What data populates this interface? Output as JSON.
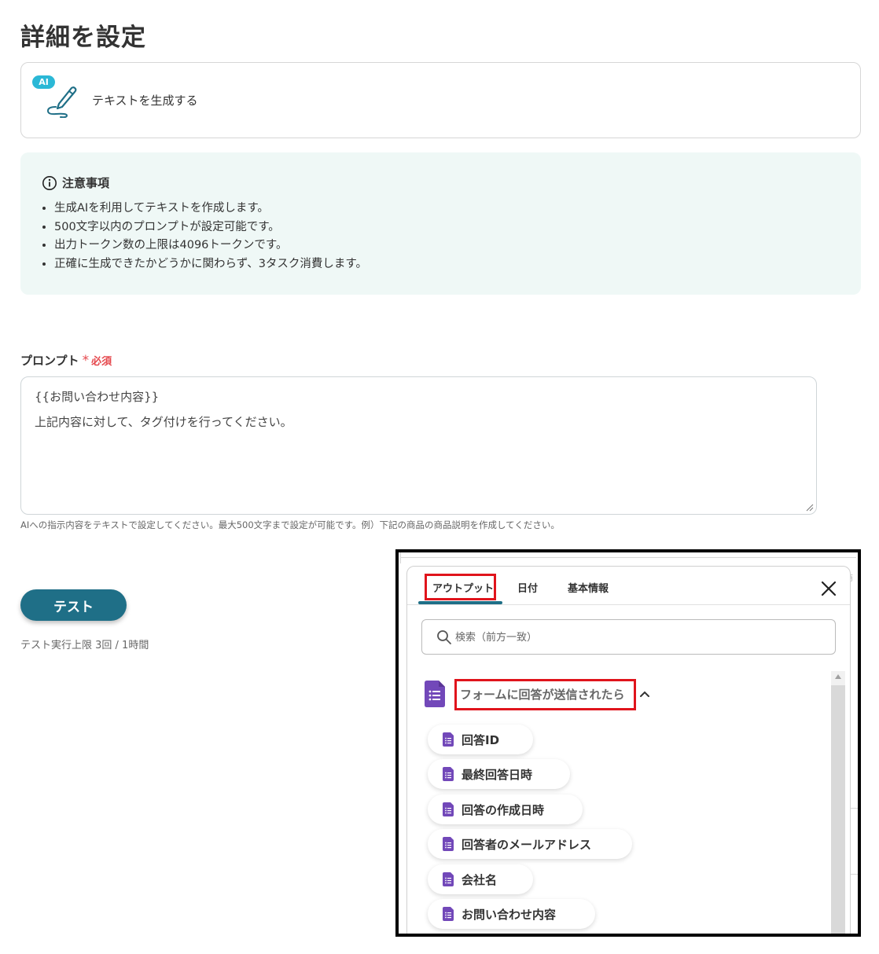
{
  "page": {
    "title": "詳細を設定"
  },
  "action": {
    "badge": "AI",
    "label": "テキストを生成する",
    "icon": "pen-icon"
  },
  "notice": {
    "title": "注意事項",
    "items": [
      "生成AIを利用してテキストを作成します。",
      "500文字以内のプロンプトが設定可能です。",
      "出力トークン数の上限は4096トークンです。",
      "正確に生成できたかどうかに関わらず、3タスク消費します。"
    ]
  },
  "prompt": {
    "label": "プロンプト",
    "required_mark": "*",
    "required_text": "必須",
    "lines": [
      "{{お問い合わせ内容}}",
      "上記内容に対して、タグ付けを行ってください。"
    ],
    "hint": "AIへの指示内容をテキストで設定してください。最大500文字まで設定が可能です。例）下記の商品の商品説明を作成してください。"
  },
  "test": {
    "button_label": "テスト",
    "limit_text": "テスト実行上限 3回 / 1時間"
  },
  "popup": {
    "bg_peek_text": "商",
    "tabs": [
      {
        "label": "アウトプット",
        "active": true
      },
      {
        "label": "日付",
        "active": false
      },
      {
        "label": "基本情報",
        "active": false
      }
    ],
    "search_placeholder": "検索（前方一致）",
    "group_title": "フォームに回答が送信されたら",
    "items": [
      "回答ID",
      "最終回答日時",
      "回答の作成日時",
      "回答者のメールアドレス",
      "会社名",
      "お問い合わせ内容"
    ]
  },
  "colors": {
    "accent": "#1f6f87",
    "highlight": "#e0141c",
    "form_icon": "#7248b9",
    "notice_bg": "#eff8f6",
    "required": "#e5484d"
  }
}
